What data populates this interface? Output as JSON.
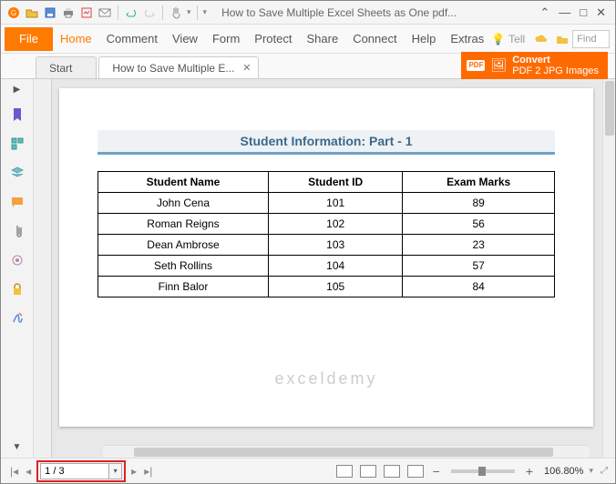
{
  "window": {
    "title": "How to Save Multiple Excel Sheets as One pdf..."
  },
  "menu": {
    "file": "File",
    "items": [
      "Home",
      "Comment",
      "View",
      "Form",
      "Protect",
      "Share",
      "Connect",
      "Help",
      "Extras"
    ],
    "tell": "Tell",
    "find": "Find"
  },
  "tabs": {
    "start": "Start",
    "doc": "How to Save Multiple E..."
  },
  "convert": {
    "line1": "Convert",
    "line2": "PDF 2 JPG Images",
    "badge": "PDF"
  },
  "document": {
    "title": "Student Information: Part - 1",
    "headers": [
      "Student Name",
      "Student ID",
      "Exam Marks"
    ],
    "rows": [
      [
        "John Cena",
        "101",
        "89"
      ],
      [
        "Roman Reigns",
        "102",
        "56"
      ],
      [
        "Dean Ambrose",
        "103",
        "23"
      ],
      [
        "Seth Rollins",
        "104",
        "57"
      ],
      [
        "Finn Balor",
        "105",
        "84"
      ]
    ],
    "watermark": "exceldemy"
  },
  "status": {
    "page": "1 / 3",
    "zoom": "106.80%"
  }
}
